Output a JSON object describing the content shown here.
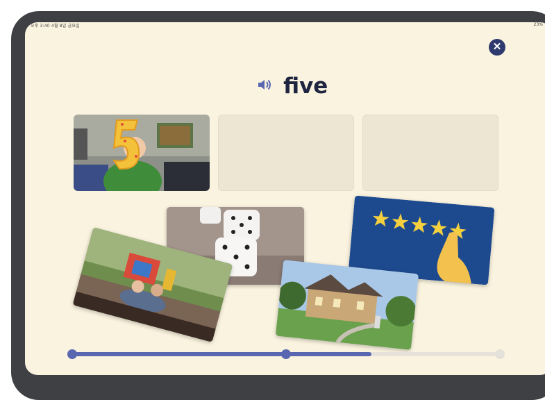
{
  "status_bar": {
    "left_text": "오후 3:40  4월 8일 금요일",
    "right_text": "23%"
  },
  "close_button": {
    "icon": "close-icon",
    "glyph": "✕"
  },
  "prompt": {
    "icon": "speaker-icon",
    "word": "five"
  },
  "answer_slots": 3,
  "cards": [
    "child-holding-number-five",
    "dice-showing-five",
    "five-stars",
    "children-on-playground",
    "house"
  ],
  "progress": {
    "value": 0.7,
    "checkpoints": 3
  },
  "colors": {
    "background": "#faf3df",
    "accent": "#5966b0",
    "close_button": "#2e3a6e",
    "slot": "#ede6d3",
    "bezel": "#3f4043"
  }
}
